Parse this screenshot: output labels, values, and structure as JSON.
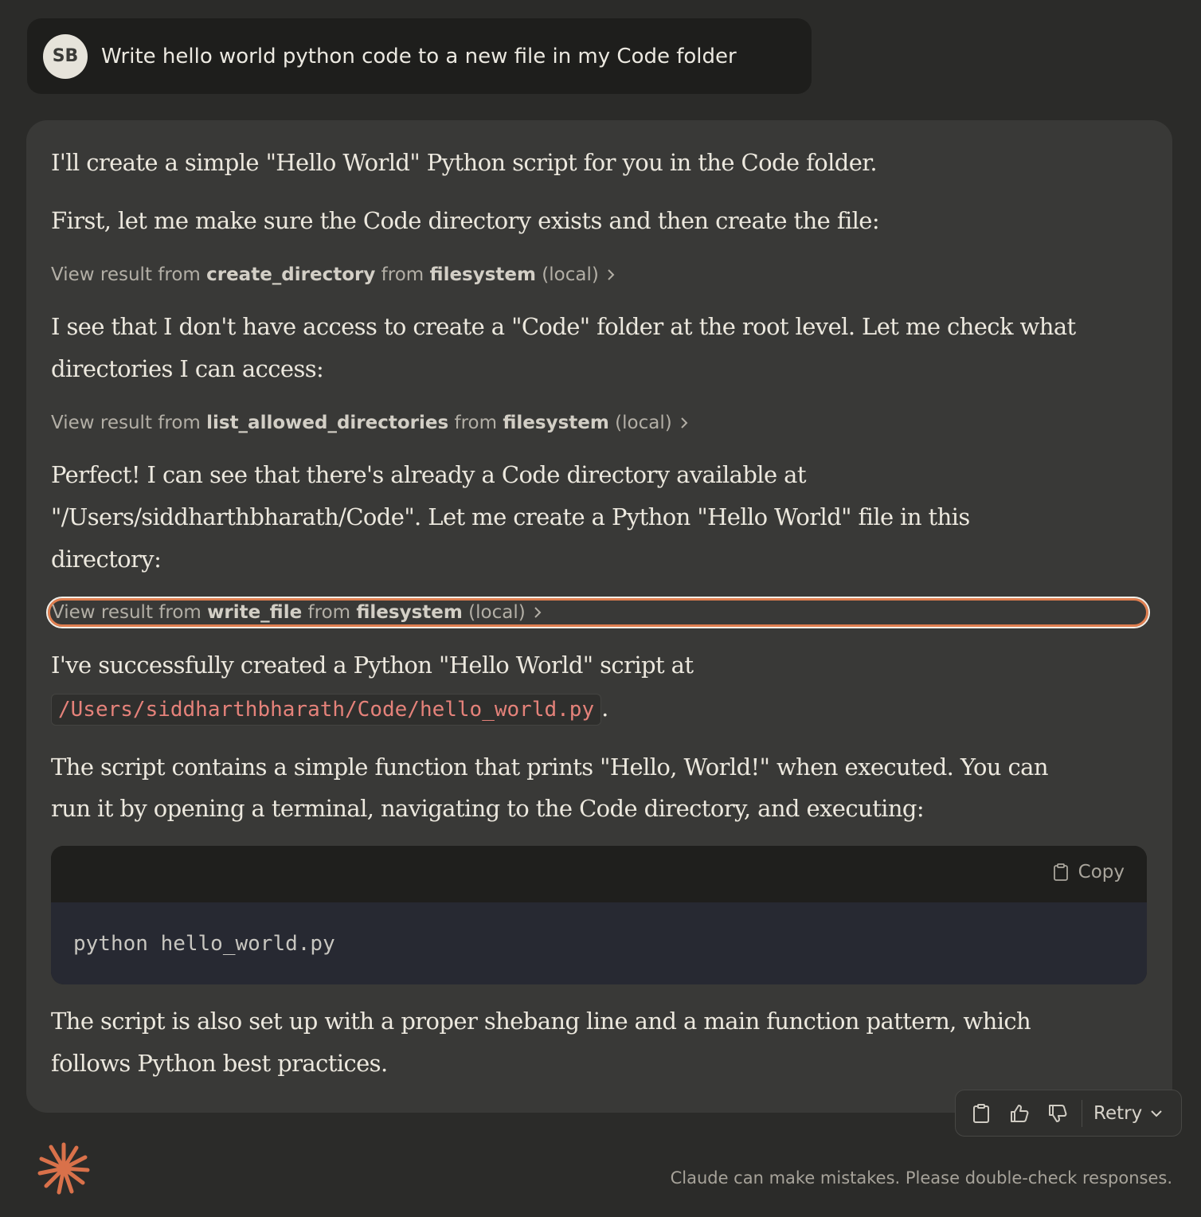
{
  "user": {
    "avatar_initials": "SB",
    "message": "Write hello world python code to a new file in my Code folder"
  },
  "assistant": {
    "p1": "I'll create a simple \"Hello World\" Python script for you in the Code folder.",
    "p2": "First, let me make sure the Code directory exists and then create the file:",
    "tool1": {
      "prefix": "View result from ",
      "tool": "create_directory",
      "mid": " from ",
      "server": "filesystem",
      "suffix": " (local)"
    },
    "p3_line1": "I see that I don't have access to create a \"Code\" folder at the root level. Let me check what",
    "p3_line2": "directories I can access:",
    "tool2": {
      "prefix": "View result from ",
      "tool": "list_allowed_directories",
      "mid": " from ",
      "server": "filesystem",
      "suffix": " (local)"
    },
    "p4_line1": "Perfect! I can see that there's already a Code directory available at",
    "p4_line2": "\"/Users/siddharthbharath/Code\". Let me create a Python \"Hello World\" file in this",
    "p4_line3": "directory:",
    "tool3": {
      "prefix": "View result from ",
      "tool": "write_file",
      "mid": " from ",
      "server": "filesystem",
      "suffix": " (local)"
    },
    "p5_line1": "I've successfully created a Python \"Hello World\" script at",
    "p5_code": "/Users/siddharthbharath/Code/hello_world.py",
    "p5_end": ".",
    "p6_line1": "The script contains a simple function that prints \"Hello, World!\" when executed. You can",
    "p6_line2": "run it by opening a terminal, navigating to the Code directory, and executing:",
    "code_block": {
      "copy_label": "Copy",
      "code": "python hello_world.py"
    },
    "p7_line1": "The script is also set up with a proper shebang line and a main function pattern, which",
    "p7_line2": "follows Python best practices."
  },
  "actions": {
    "retry_label": "Retry",
    "icons": [
      "copy-icon",
      "thumbs-up-icon",
      "thumbs-down-icon",
      "chevron-down-icon"
    ]
  },
  "footer": {
    "disclaimer": "Claude can make mistakes. Please double-check responses."
  },
  "colors": {
    "background": "#2b2b29",
    "card": "#393937",
    "accent": "#e07e4f",
    "inline_code": "#e5827a"
  }
}
